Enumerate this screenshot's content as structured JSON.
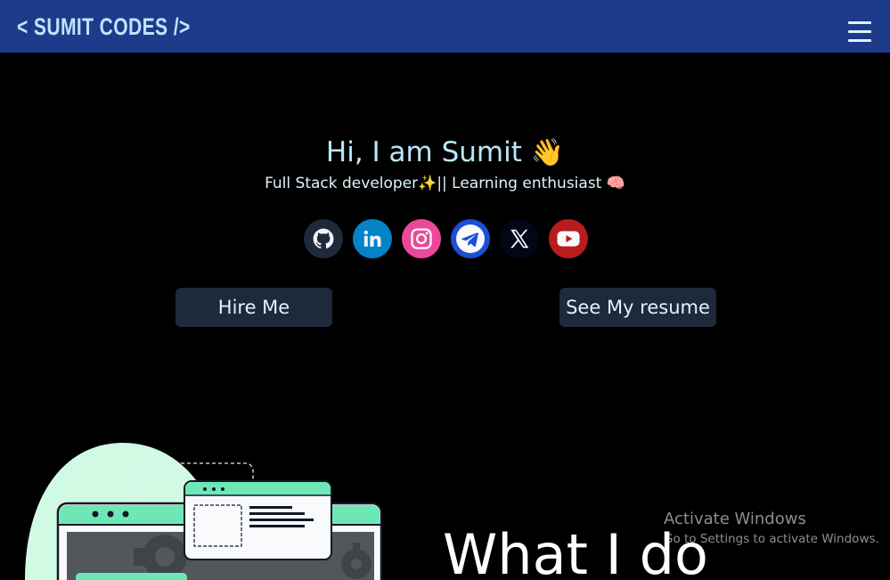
{
  "navbar": {
    "brand": "< SUMIT CODES />",
    "menu_icon": "hamburger-menu-icon",
    "background": "#1e3a8a"
  },
  "hero": {
    "greeting": "Hi, I am Sumit",
    "greeting_emoji": "👋",
    "tagline_part1": "Full Stack developer",
    "tagline_emoji1": "✨",
    "tagline_part2": "|| Learning enthusiast",
    "tagline_emoji2": "🧠"
  },
  "socials": [
    {
      "name": "GitHub",
      "icon": "github-icon",
      "color": "#1e293b"
    },
    {
      "name": "LinkedIn",
      "icon": "linkedin-icon",
      "color": "#0284c7"
    },
    {
      "name": "Instagram",
      "icon": "instagram-icon",
      "color": "#ec4899"
    },
    {
      "name": "Telegram",
      "icon": "telegram-icon",
      "color": "#1d4ed8"
    },
    {
      "name": "X",
      "icon": "x-icon",
      "color": "#020617"
    },
    {
      "name": "YouTube",
      "icon": "youtube-icon",
      "color": "#b91c1c"
    }
  ],
  "buttons": {
    "hire": "Hire Me",
    "resume": "See My resume"
  },
  "section": {
    "what_i_do": "What I do"
  },
  "overlay": {
    "activate_title": "Activate Windows",
    "activate_subtitle": "Go to Settings to activate Windows."
  }
}
